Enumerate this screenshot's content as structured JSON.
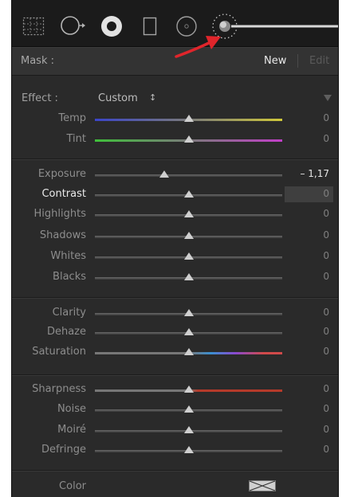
{
  "toolbar": {
    "tools": [
      {
        "icon": "crop-overlay-icon"
      },
      {
        "icon": "spot-removal-icon"
      },
      {
        "icon": "red-eye-icon"
      },
      {
        "icon": "graduated-filter-icon"
      },
      {
        "icon": "radial-filter-icon"
      },
      {
        "icon": "adjustment-brush-icon"
      }
    ]
  },
  "mask": {
    "label": "Mask :",
    "new_label": "New",
    "edit_label": "Edit"
  },
  "effect": {
    "label": "Effect :",
    "value": "Custom",
    "arrows": "↕"
  },
  "sliders": [
    {
      "label": "Temp",
      "value": "0",
      "level": 0.5,
      "track": "temp"
    },
    {
      "label": "Tint",
      "value": "0",
      "level": 0.5,
      "track": "tint"
    },
    {
      "label": "Exposure",
      "value": "– 1,17",
      "level": 0.37,
      "track": "plain"
    },
    {
      "label": "Contrast",
      "value": "0",
      "level": 0.5,
      "track": "plain",
      "active": true
    },
    {
      "label": "Highlights",
      "value": "0",
      "level": 0.5,
      "track": "plain"
    },
    {
      "label": "Shadows",
      "value": "0",
      "level": 0.5,
      "track": "plain"
    },
    {
      "label": "Whites",
      "value": "0",
      "level": 0.5,
      "track": "plain"
    },
    {
      "label": "Blacks",
      "value": "0",
      "level": 0.5,
      "track": "plain"
    },
    {
      "label": "Clarity",
      "value": "0",
      "level": 0.5,
      "track": "plain"
    },
    {
      "label": "Dehaze",
      "value": "0",
      "level": 0.5,
      "track": "plain"
    },
    {
      "label": "Saturation",
      "value": "0",
      "level": 0.5,
      "track": "saturation"
    },
    {
      "label": "Sharpness",
      "value": "0",
      "level": 0.5,
      "track": "sharpness"
    },
    {
      "label": "Noise",
      "value": "0",
      "level": 0.5,
      "track": "plain"
    },
    {
      "label": "Moiré",
      "value": "0",
      "level": 0.5,
      "track": "plain"
    },
    {
      "label": "Defringe",
      "value": "0",
      "level": 0.5,
      "track": "plain"
    }
  ],
  "color": {
    "label": "Color"
  },
  "colors": {
    "panel": "#2a2a2a",
    "annotation_arrow": "#e0252b",
    "temp_left": "#3b45c8",
    "temp_right": "#cfc83a",
    "tint_left": "#3fbf3a",
    "tint_right": "#c13fc8",
    "sharp_right": "#b53a2a"
  }
}
